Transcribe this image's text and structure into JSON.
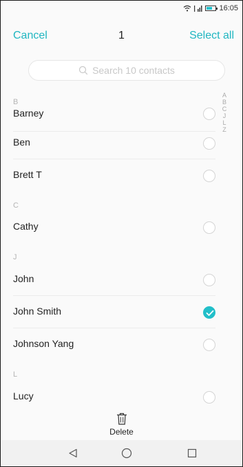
{
  "status": {
    "time": "16:05"
  },
  "header": {
    "cancel": "Cancel",
    "count": "1",
    "select_all": "Select all"
  },
  "search": {
    "placeholder": "Search 10 contacts"
  },
  "sections": [
    {
      "letter": "B",
      "contacts": [
        {
          "name": "Barney",
          "checked": false
        },
        {
          "name": "Ben",
          "checked": false
        },
        {
          "name": "Brett T",
          "checked": false
        }
      ]
    },
    {
      "letter": "C",
      "contacts": [
        {
          "name": "Cathy",
          "checked": false
        }
      ]
    },
    {
      "letter": "J",
      "contacts": [
        {
          "name": "John",
          "checked": false
        },
        {
          "name": "John Smith",
          "checked": true
        },
        {
          "name": "Johnson Yang",
          "checked": false
        }
      ]
    },
    {
      "letter": "L",
      "contacts": [
        {
          "name": "Lucy",
          "checked": false
        }
      ]
    }
  ],
  "alpha_index": [
    "A",
    "B",
    "C",
    "J",
    "L",
    "Z"
  ],
  "bottom_action": {
    "label": "Delete",
    "icon": "trash-icon"
  },
  "nav": {
    "icons": [
      "back-icon",
      "home-icon",
      "recents-icon"
    ]
  },
  "colors": {
    "accent": "#1fb6c1",
    "check": "#22bfc9"
  }
}
